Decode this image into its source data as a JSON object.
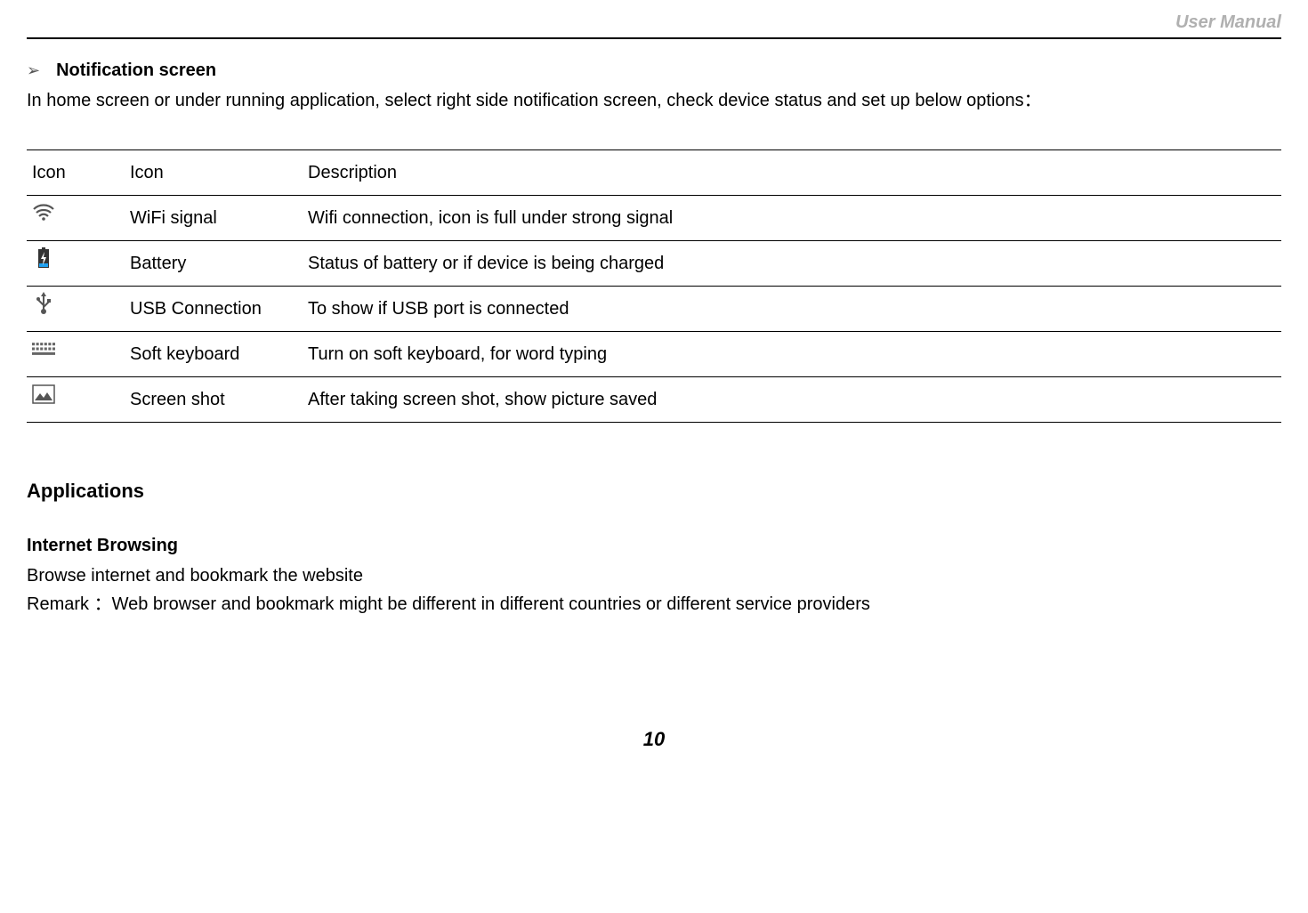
{
  "header": {
    "manual_label": "User Manual"
  },
  "section1": {
    "title": "Notification screen",
    "intro": "In home screen or under running application, select right side notification screen, check device status and set up below options："
  },
  "table": {
    "headers": {
      "col1": "Icon",
      "col2": "Icon",
      "col3": "Description"
    },
    "rows": [
      {
        "name": "WiFi signal",
        "desc": "Wifi connection, icon is full under strong signal"
      },
      {
        "name": "Battery",
        "desc": "Status of battery or if device is being charged"
      },
      {
        "name": "USB Connection",
        "desc": "To show if USB port is connected"
      },
      {
        "name": "Soft keyboard",
        "desc": "Turn on soft keyboard, for word typing"
      },
      {
        "name": "Screen shot",
        "desc": "After taking screen shot, show picture saved"
      }
    ]
  },
  "applications": {
    "heading": "Applications",
    "sub": "Internet Browsing",
    "line1": "Browse internet and bookmark the website",
    "line2": "Remark ：Web browser and bookmark might be different in different countries or different service providers"
  },
  "page_number": "10"
}
